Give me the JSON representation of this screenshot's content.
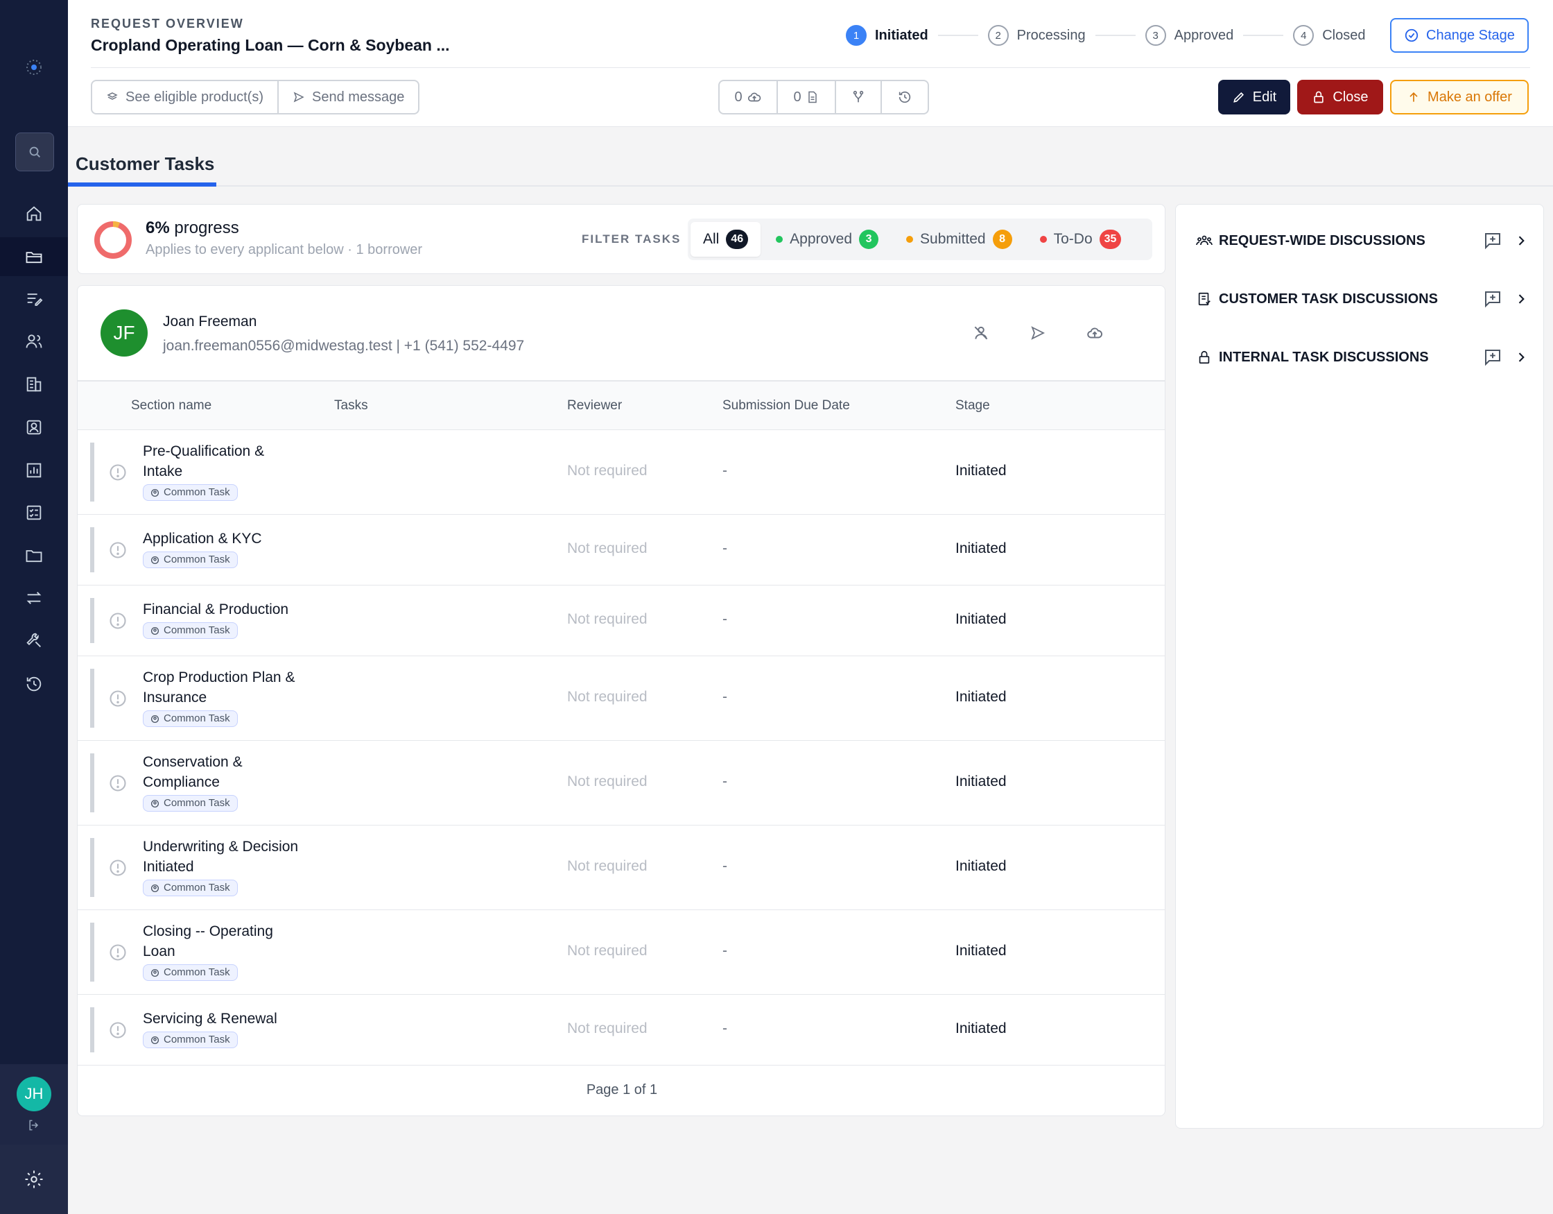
{
  "header": {
    "eyebrow": "REQUEST OVERVIEW",
    "title": "Cropland Operating Loan — Corn & Soybean ...",
    "stages": [
      {
        "num": "1",
        "label": "Initiated",
        "active": true
      },
      {
        "num": "2",
        "label": "Processing",
        "active": false
      },
      {
        "num": "3",
        "label": "Approved",
        "active": false
      },
      {
        "num": "4",
        "label": "Closed",
        "active": false
      }
    ],
    "change_stage_label": "Change Stage",
    "see_products_label": "See eligible product(s)",
    "send_message_label": "Send message",
    "upload_count": "0",
    "document_count": "0",
    "edit_label": "Edit",
    "close_label": "Close",
    "offer_label": "Make an offer"
  },
  "tabs": {
    "active_label": "Customer Tasks"
  },
  "progress": {
    "percent_text": "6%",
    "percent_value": 6,
    "suffix": "progress",
    "subtitle": "Applies to every applicant below · 1 borrower"
  },
  "filters": {
    "label": "FILTER TASKS",
    "items": [
      {
        "label": "All",
        "count": "46",
        "dot": "",
        "badge_color": "#111827"
      },
      {
        "label": "Approved",
        "count": "3",
        "dot": "#22c55e",
        "badge_color": "#22c55e"
      },
      {
        "label": "Submitted",
        "count": "8",
        "dot": "#f59e0b",
        "badge_color": "#f59e0b"
      },
      {
        "label": "To-Do",
        "count": "35",
        "dot": "#ef4444",
        "badge_color": "#ef4444"
      }
    ]
  },
  "applicant": {
    "initials": "JF",
    "name": "Joan Freeman",
    "contact": "joan.freeman0556@midwestag.test | +1 (541) 552-4497"
  },
  "table": {
    "headers": {
      "section": "Section name",
      "tasks": "Tasks",
      "reviewer": "Reviewer",
      "due": "Submission Due Date",
      "stage": "Stage"
    },
    "rows": [
      {
        "name_lines": [
          "Pre-Qualification &",
          "Intake"
        ],
        "tag": "Common Task",
        "reviewer": "Not required",
        "due": "-",
        "stage": "Initiated"
      },
      {
        "name_lines": [
          "Application & KYC"
        ],
        "tag": "Common Task",
        "reviewer": "Not required",
        "due": "-",
        "stage": "Initiated"
      },
      {
        "name_lines": [
          "Financial & Production"
        ],
        "tag": "Common Task",
        "reviewer": "Not required",
        "due": "-",
        "stage": "Initiated"
      },
      {
        "name_lines": [
          "Crop Production Plan &",
          "Insurance"
        ],
        "tag": "Common Task",
        "reviewer": "Not required",
        "due": "-",
        "stage": "Initiated"
      },
      {
        "name_lines": [
          "Conservation &",
          "Compliance"
        ],
        "tag": "Common Task",
        "reviewer": "Not required",
        "due": "-",
        "stage": "Initiated"
      },
      {
        "name_lines": [
          "Underwriting & Decision",
          "Initiated"
        ],
        "tag": "Common Task",
        "reviewer": "Not required",
        "due": "-",
        "stage": "Initiated"
      },
      {
        "name_lines": [
          "Closing -- Operating",
          "Loan"
        ],
        "tag": "Common Task",
        "reviewer": "Not required",
        "due": "-",
        "stage": "Initiated"
      },
      {
        "name_lines": [
          "Servicing & Renewal"
        ],
        "tag": "Common Task",
        "reviewer": "Not required",
        "due": "-",
        "stage": "Initiated"
      }
    ],
    "pager": "Page 1 of 1"
  },
  "discussions": [
    {
      "label": "REQUEST-WIDE DISCUSSIONS",
      "icon": "users-icon"
    },
    {
      "label": "CUSTOMER TASK DISCUSSIONS",
      "icon": "task-list-icon"
    },
    {
      "label": "INTERNAL TASK DISCUSSIONS",
      "icon": "lock-icon"
    }
  ],
  "sidebar": {
    "user_initials": "JH",
    "items": [
      "home-icon",
      "folder-open-icon",
      "edit-list-icon",
      "users-icon",
      "building-icon",
      "contact-card-icon",
      "chart-icon",
      "checklist-icon",
      "folder-icon",
      "transfer-icon",
      "tools-icon",
      "history-icon"
    ]
  },
  "colors": {
    "sidebar_bg": "#141d3a",
    "accent": "#2563eb",
    "danger": "#a01818",
    "warning": "#f59e0b",
    "success": "#22c55e"
  }
}
